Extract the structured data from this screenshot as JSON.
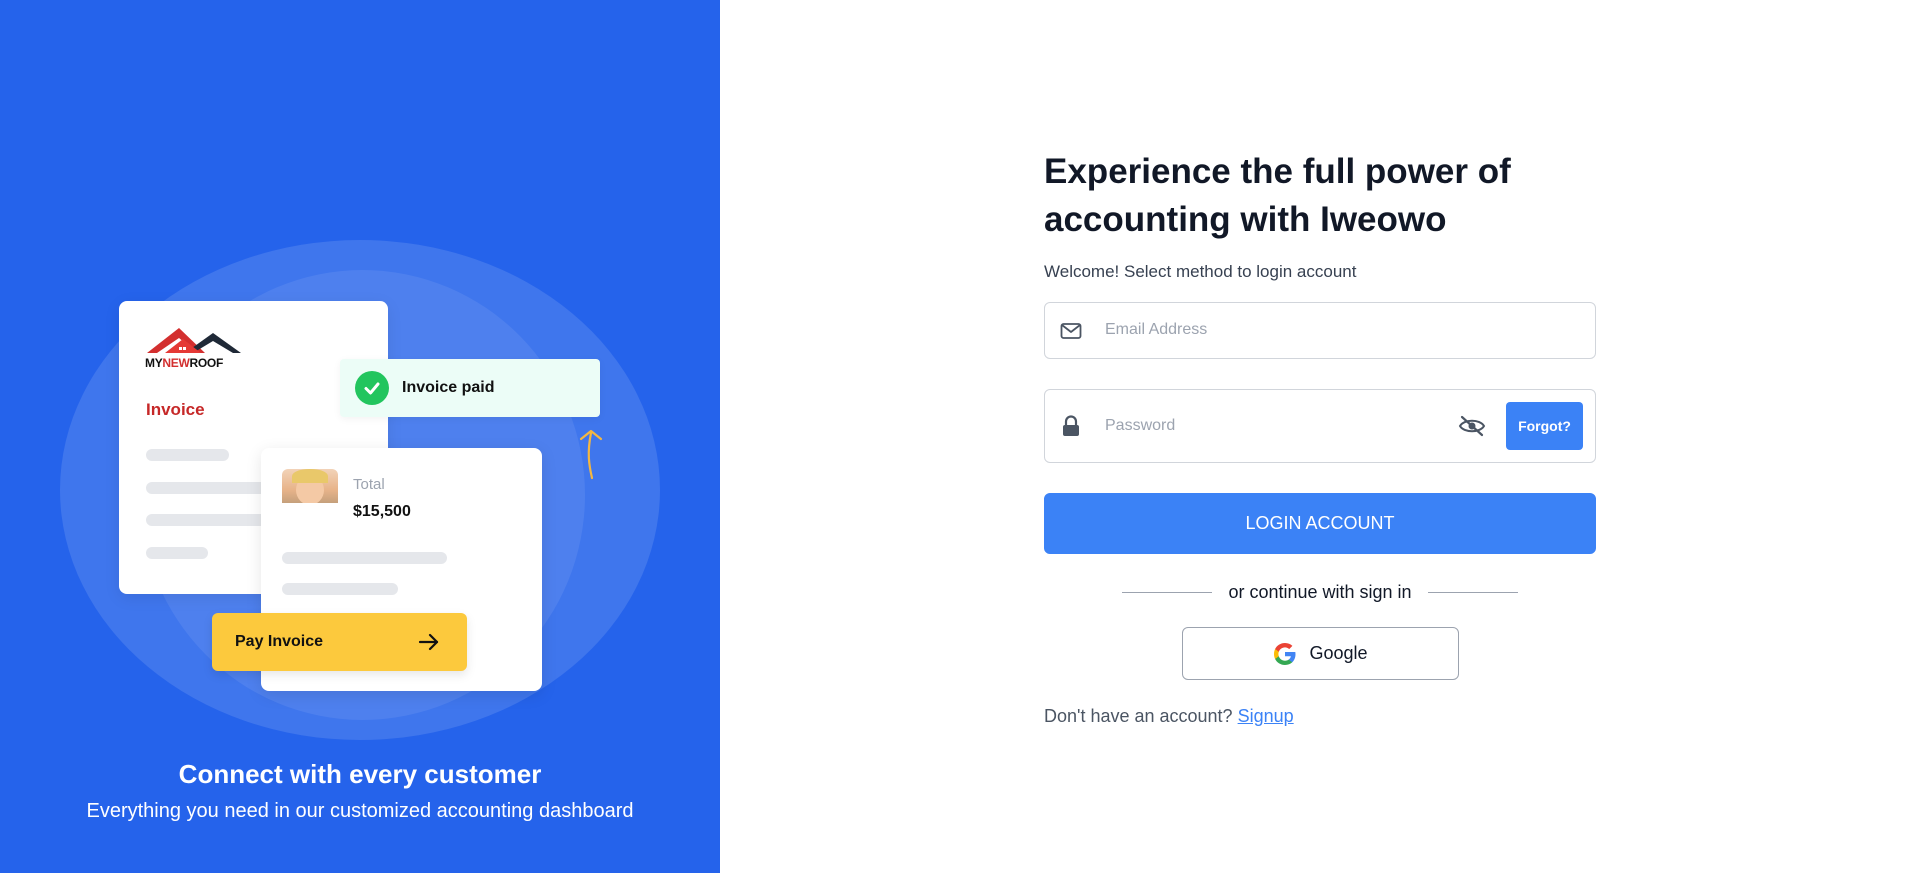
{
  "left_panel": {
    "brand": {
      "part1": "MY",
      "part2": "NEW",
      "part3": "ROOF"
    },
    "invoice_title": "Invoice",
    "toast_text": "Invoice paid",
    "total_label": "Total",
    "total_value": "$15,500",
    "pay_button_label": "Pay Invoice",
    "heading": "Connect with every customer",
    "subheading": "Everything you need in our customized accounting dashboard"
  },
  "form": {
    "headline": "Experience the full power of accounting with Iweowo",
    "welcome": "Welcome! Select method to login account",
    "email_placeholder": "Email Address",
    "email_value": "",
    "password_placeholder": "Password",
    "password_value": "",
    "forgot_label": "Forgot?",
    "login_label": "LOGIN ACCOUNT",
    "divider_text": "or continue with sign in",
    "google_label": "Google",
    "signup_prompt": "Don't have an account?",
    "signup_link": "Signup"
  },
  "colors": {
    "left_bg": "#2563EB",
    "primary": "#3B82F6",
    "pay_yellow": "#FCC93D",
    "success_green": "#22C55E",
    "brand_red": "#C62828"
  },
  "icons": [
    "house-roof-logo",
    "check-circle-icon",
    "arrow-right-icon",
    "doodle-arrow-icon",
    "envelope-icon",
    "lock-icon",
    "eye-off-icon",
    "google-icon"
  ]
}
